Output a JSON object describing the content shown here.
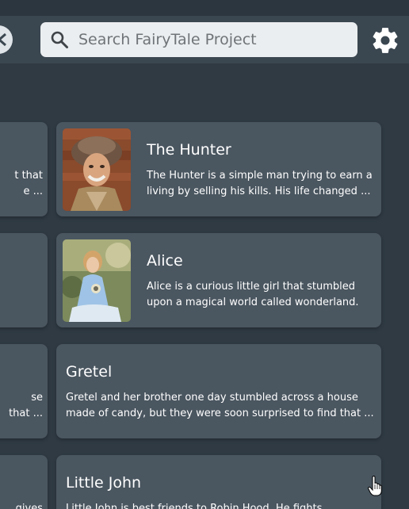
{
  "search": {
    "placeholder": "Search FairyTale Project"
  },
  "icons": {
    "back": "back-arrow-icon",
    "search": "search-icon",
    "settings": "gear-icon",
    "cursor": "hand-pointer-icon"
  },
  "colors": {
    "background": "#2f3a43",
    "header": "#3a4650",
    "card": "#4a5660",
    "search_bg": "#ebeef0"
  },
  "left_cards": [
    {
      "line1": "t that",
      "line2": "e ..."
    },
    {
      "line1": "",
      "line2": ""
    },
    {
      "line1": "se",
      "line2": "that ..."
    },
    {
      "line1": "gives",
      "line2": ""
    }
  ],
  "characters": [
    {
      "name": "The Hunter",
      "desc_line1": "The Hunter is a simple man trying to earn a",
      "desc_line2": "living by selling his kills. His life changed ...",
      "has_image": true
    },
    {
      "name": "Alice",
      "desc_line1": "Alice is a curious little girl that stumbled",
      "desc_line2": "upon a magical world called wonderland.",
      "has_image": true
    },
    {
      "name": "Gretel",
      "desc_line1": "Gretel and her brother  one day stumbled across a house",
      "desc_line2": "made of candy, but they were soon surprised to find that ...",
      "has_image": false
    },
    {
      "name": "Little John",
      "desc_line1": "Little John is best friends to Robin Hood. He fights",
      "desc_line2": "",
      "has_image": false
    }
  ]
}
